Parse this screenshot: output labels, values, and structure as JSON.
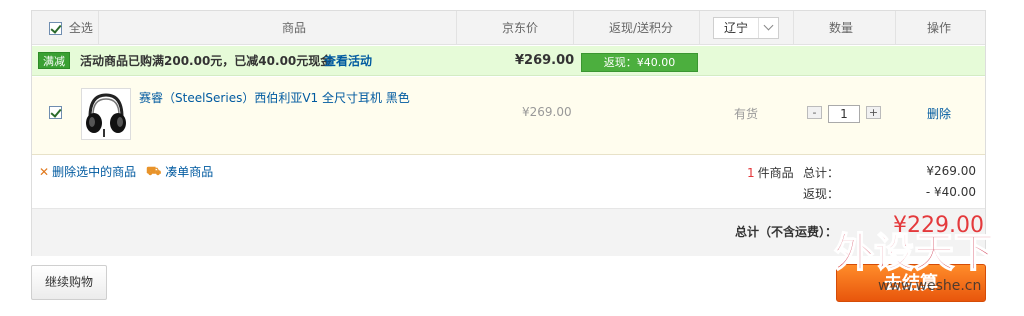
{
  "header": {
    "select_all": "全选",
    "col_product": "商品",
    "col_price": "京东价",
    "col_rebate": "返现/送积分",
    "region": "辽宁",
    "col_qty": "数量",
    "col_ops": "操作"
  },
  "promo": {
    "badge": "满减",
    "text": "活动商品已购满200.00元，已减40.00元现金",
    "link": "查看活动",
    "price": "¥269.00",
    "rebate": "返现：¥40.00"
  },
  "item": {
    "name": "赛睿（SteelSeries）西伯利亚V1 全尺寸耳机 黑色",
    "price": "¥269.00",
    "stock": "有货",
    "qty": "1",
    "minus": "-",
    "plus": "+",
    "delete": "删除"
  },
  "summary": {
    "delete_selected": "删除选中的商品",
    "bundle": "凑单商品",
    "count": "1",
    "count_unit": "件商品",
    "total_label": "总计：",
    "total_value": "¥269.00",
    "rebate_label": "返现：",
    "rebate_value": "- ¥40.00",
    "grand_label": "总计（不含运费）：",
    "grand_value": "¥229.00"
  },
  "buttons": {
    "continue": "继续购物",
    "checkout": "去结算"
  },
  "watermark": {
    "brand": "外设天下",
    "url": "www.weshe.cn"
  },
  "colors": {
    "link": "#005aa0",
    "promo_bg": "#e6fbd8",
    "badge_green": "#3aa033",
    "price_red": "#e4393c",
    "checkout_orange": "#f47a1f",
    "watermark_red": "#c8102e"
  },
  "icons": {
    "select_all_checkbox": "checkbox-checked-icon",
    "item_checkbox": "checkbox-checked-icon",
    "delete_selected": "x-icon",
    "bundle": "cart-icon",
    "region_dropdown": "chevron-down-icon",
    "thumbnail": "headphones-image"
  }
}
